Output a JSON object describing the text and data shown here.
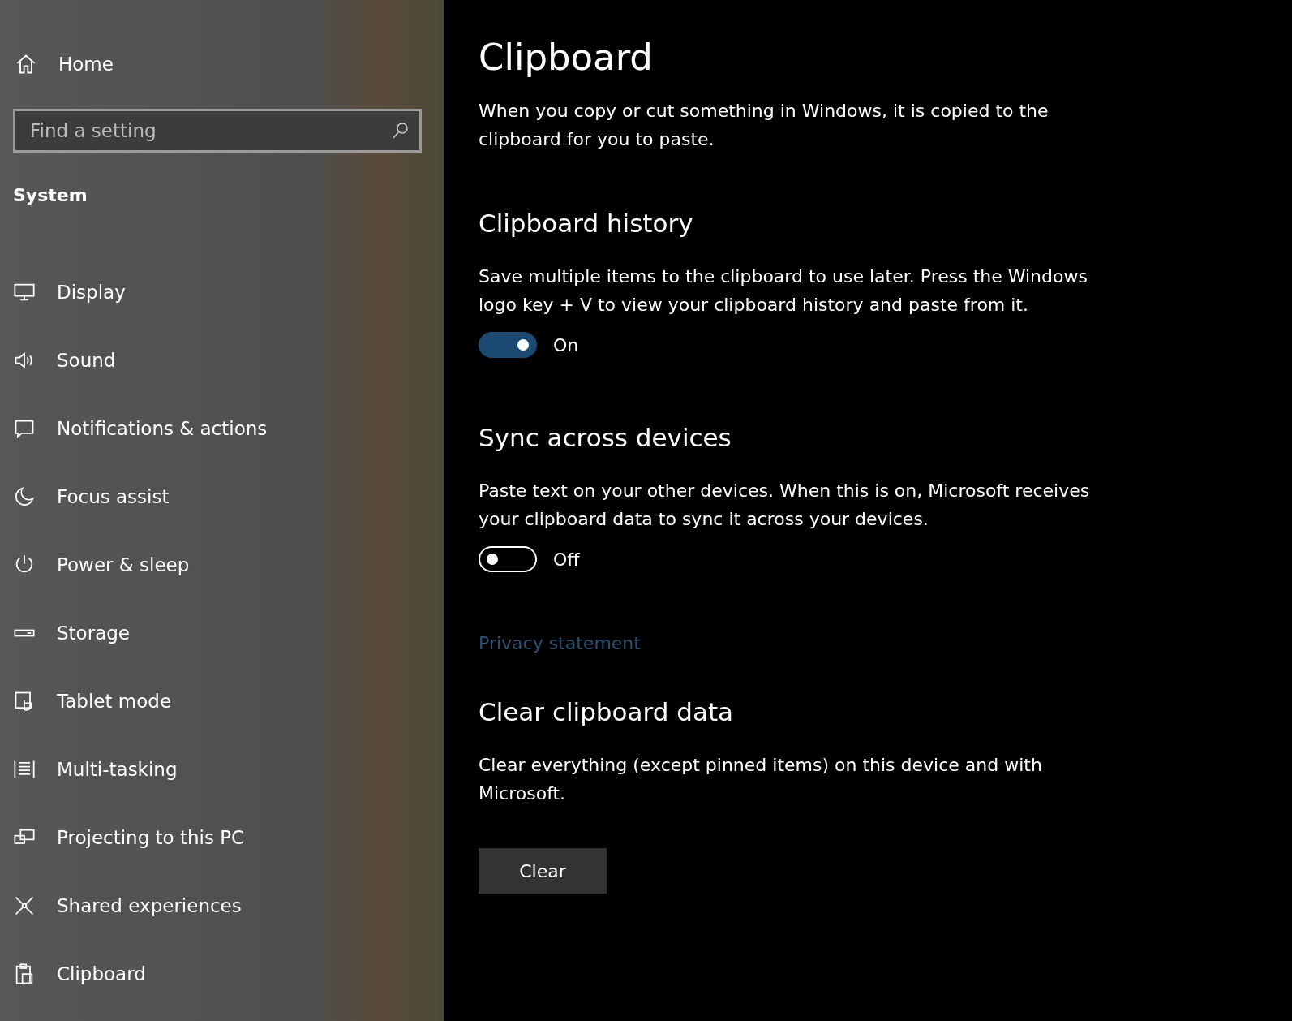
{
  "sidebar": {
    "home": "Home",
    "search": {
      "placeholder": "Find a setting"
    },
    "section": "System",
    "items": [
      {
        "label": "Display",
        "selected": false
      },
      {
        "label": "Sound",
        "selected": false
      },
      {
        "label": "Notifications & actions",
        "selected": false
      },
      {
        "label": "Focus assist",
        "selected": false
      },
      {
        "label": "Power & sleep",
        "selected": false
      },
      {
        "label": "Storage",
        "selected": false
      },
      {
        "label": "Tablet mode",
        "selected": false
      },
      {
        "label": "Multi-tasking",
        "selected": false
      },
      {
        "label": "Projecting to this PC",
        "selected": false
      },
      {
        "label": "Shared experiences",
        "selected": false
      },
      {
        "label": "Clipboard",
        "selected": false
      }
    ]
  },
  "page": {
    "title": "Clipboard",
    "intro": "When you copy or cut something in Windows, it is copied to the clipboard for you to paste.",
    "sections": [
      {
        "kind": "toggle",
        "heading": "Clipboard history",
        "text": "Save multiple items to the clipboard to use later. Press the Windows logo key + V to view your clipboard history and paste from it.",
        "on": true,
        "state_label": "On"
      },
      {
        "kind": "toggle",
        "heading": "Sync across devices",
        "text": "Paste text on your other devices. When this is on, Microsoft receives your clipboard data to sync it across your devices.",
        "on": false,
        "state_label": "Off",
        "link": "Privacy statement"
      },
      {
        "kind": "button",
        "heading": "Clear clipboard data",
        "text": "Clear everything (except pinned items) on this device and with Microsoft.",
        "button": "Clear"
      }
    ]
  }
}
